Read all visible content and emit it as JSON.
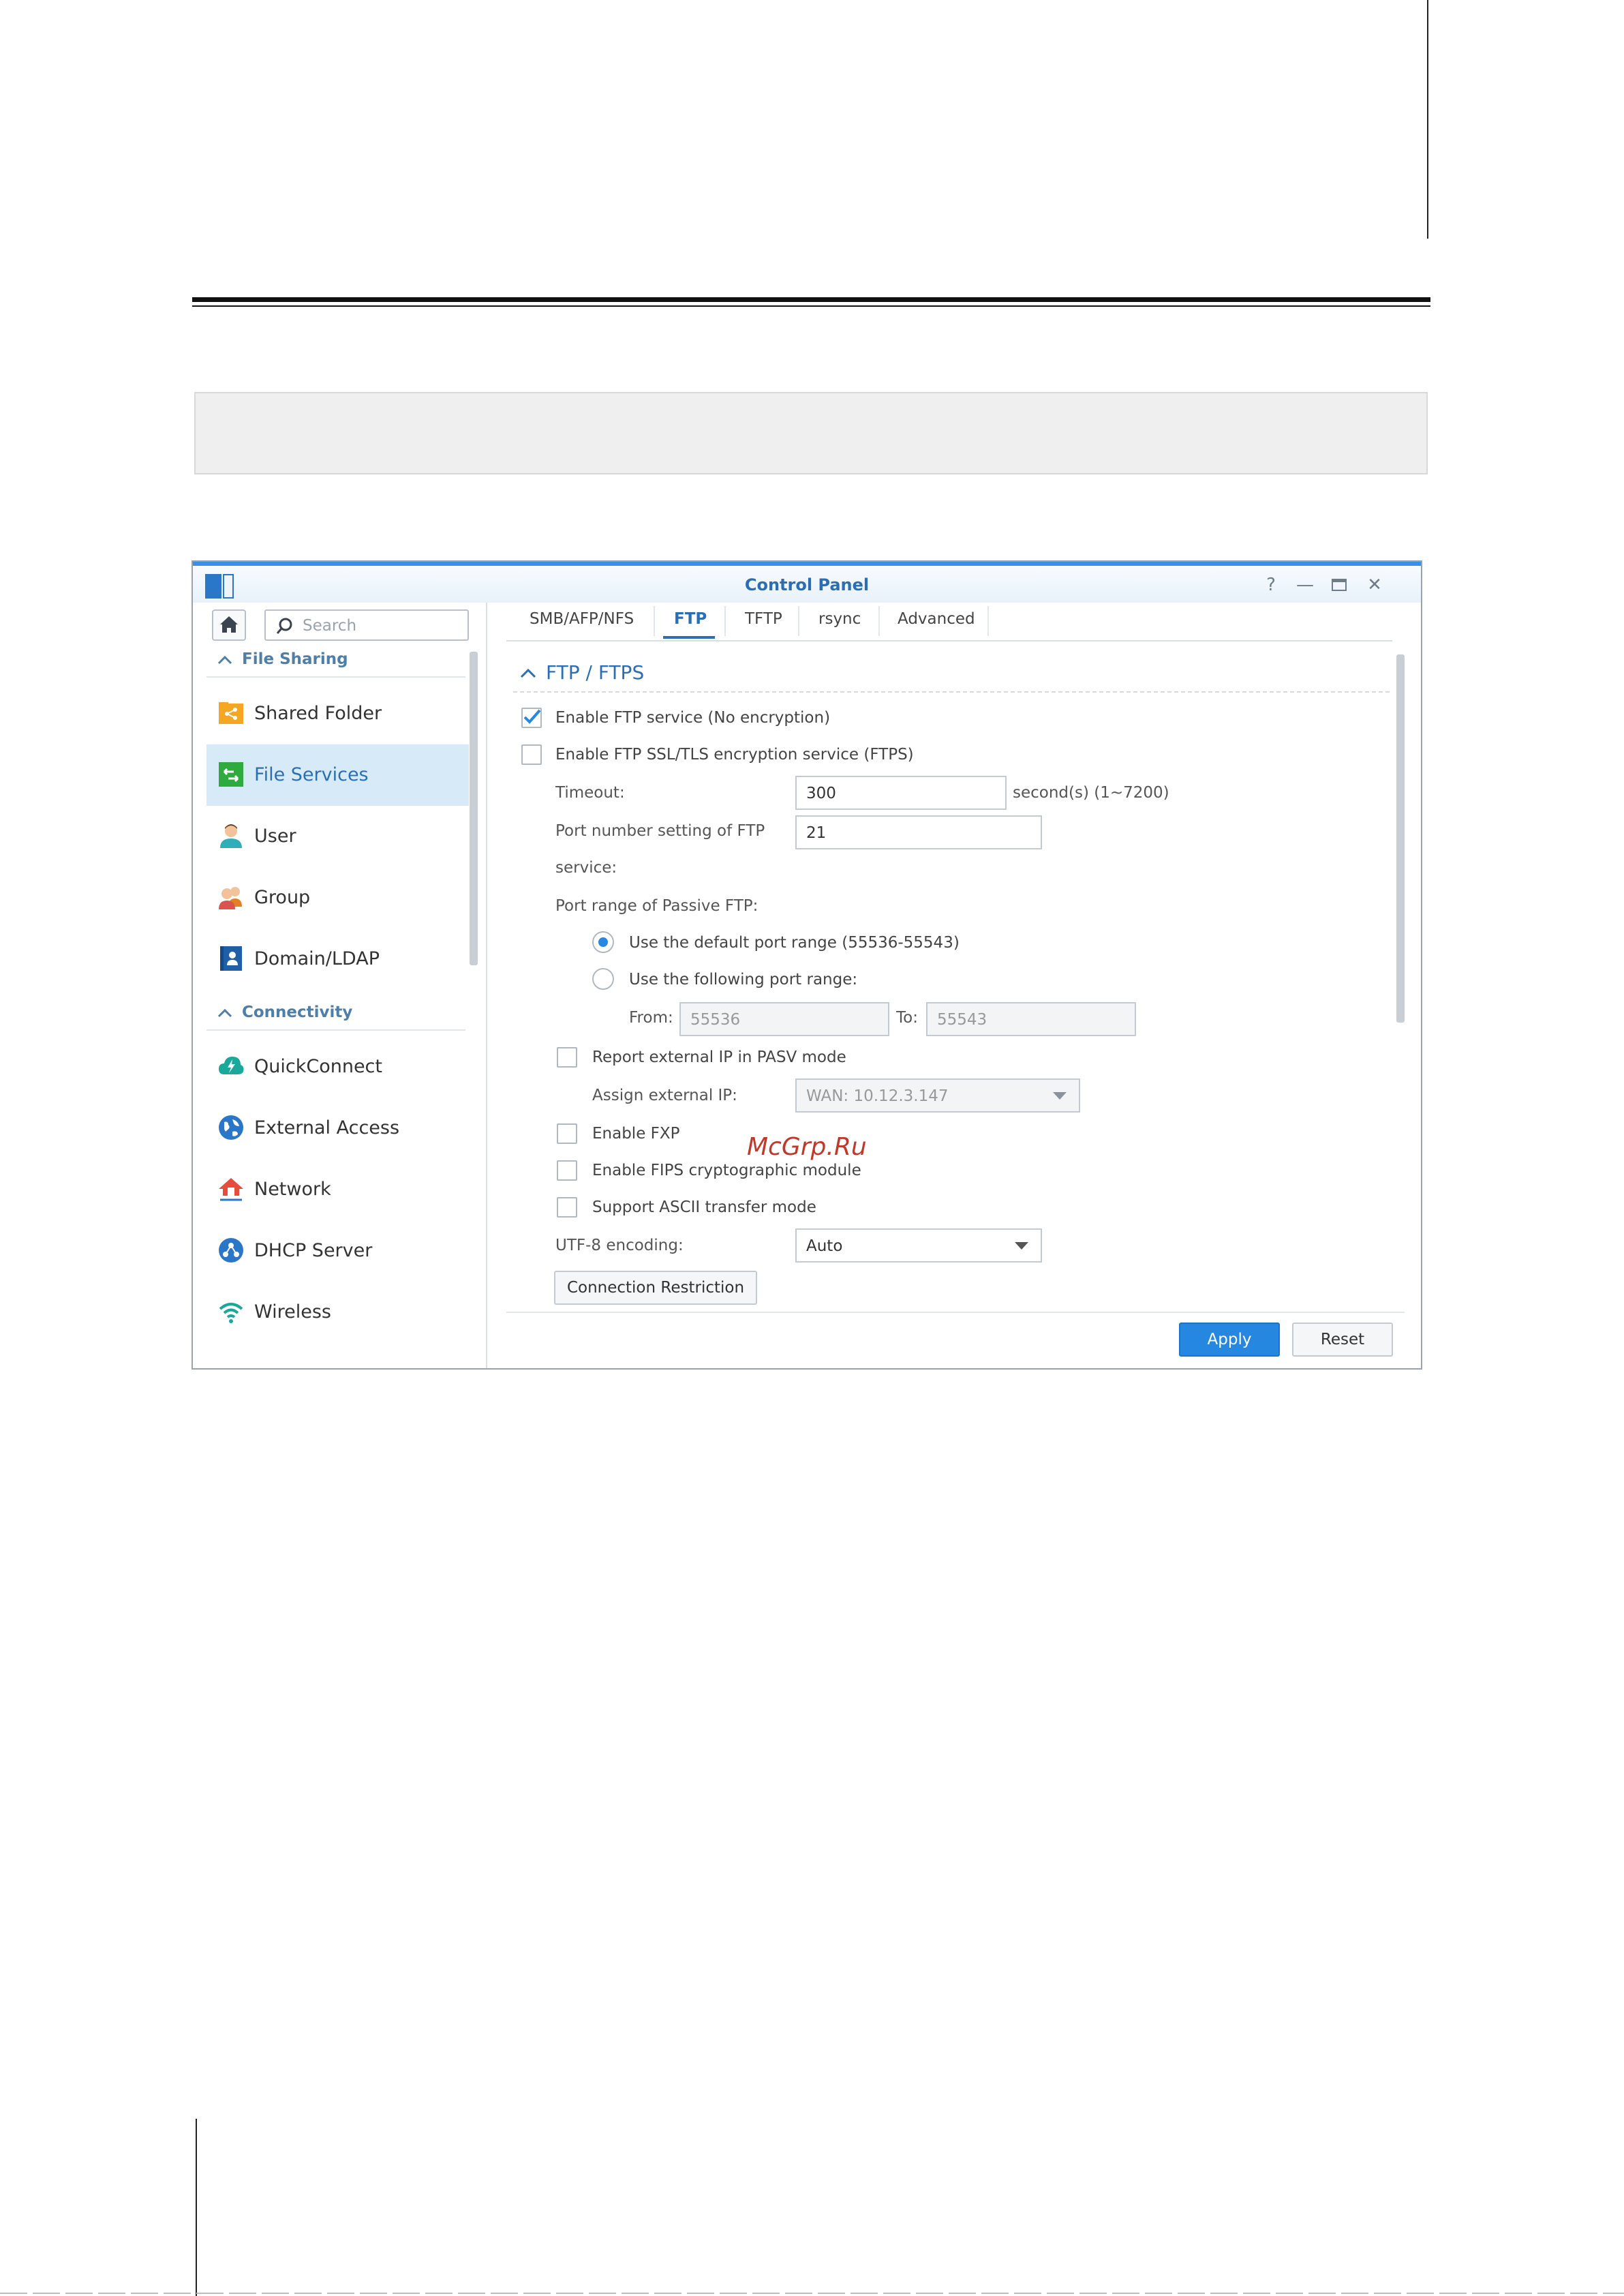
{
  "window": {
    "title": "Control Panel",
    "controls": {
      "help": "?",
      "minimize": "—",
      "maximize": "▭",
      "close": "✕"
    }
  },
  "sidebar": {
    "search_placeholder": "Search",
    "sections": [
      {
        "label": "File Sharing"
      },
      {
        "label": "Connectivity"
      }
    ],
    "items": [
      {
        "label": "Shared Folder",
        "icon": "shared-folder-icon",
        "active": false
      },
      {
        "label": "File Services",
        "icon": "file-services-icon",
        "active": true
      },
      {
        "label": "User",
        "icon": "user-icon",
        "active": false
      },
      {
        "label": "Group",
        "icon": "group-icon",
        "active": false
      },
      {
        "label": "Domain/LDAP",
        "icon": "domain-ldap-icon",
        "active": false
      },
      {
        "label": "QuickConnect",
        "icon": "quickconnect-icon",
        "active": false
      },
      {
        "label": "External Access",
        "icon": "external-access-icon",
        "active": false
      },
      {
        "label": "Network",
        "icon": "network-icon",
        "active": false
      },
      {
        "label": "DHCP Server",
        "icon": "dhcp-server-icon",
        "active": false
      },
      {
        "label": "Wireless",
        "icon": "wireless-icon",
        "active": false
      }
    ]
  },
  "tabs": [
    {
      "label": "SMB/AFP/NFS",
      "active": false
    },
    {
      "label": "FTP",
      "active": true
    },
    {
      "label": "TFTP",
      "active": false
    },
    {
      "label": "rsync",
      "active": false
    },
    {
      "label": "Advanced",
      "active": false
    }
  ],
  "ftp": {
    "section_title": "FTP / FTPS",
    "enable_ftp": {
      "label": "Enable FTP service (No encryption)",
      "checked": true
    },
    "enable_ftps": {
      "label": "Enable FTP SSL/TLS encryption service (FTPS)",
      "checked": false
    },
    "timeout": {
      "label": "Timeout:",
      "value": "300",
      "suffix": "second(s) (1~7200)"
    },
    "port": {
      "label_line1": "Port number setting of FTP",
      "label_line2": "service:",
      "value": "21"
    },
    "passive_label": "Port range of Passive FTP:",
    "default_range": {
      "label": "Use the default port range (55536-55543)",
      "selected": true
    },
    "custom_range": {
      "label": "Use the following port range:",
      "selected": false
    },
    "from": {
      "label": "From:",
      "value": "55536"
    },
    "to": {
      "label": "To:",
      "value": "55543"
    },
    "report_ext_ip": {
      "label": "Report external IP in PASV mode",
      "checked": false
    },
    "assign_ext_ip": {
      "label": "Assign external IP:",
      "value": "WAN: 10.12.3.147"
    },
    "enable_fxp": {
      "label": "Enable FXP",
      "checked": false
    },
    "enable_fips": {
      "label": "Enable FIPS cryptographic module",
      "checked": false
    },
    "ascii_mode": {
      "label": "Support ASCII transfer mode",
      "checked": false
    },
    "utf8": {
      "label": "UTF-8 encoding:",
      "value": "Auto"
    },
    "connection_restriction": "Connection Restriction"
  },
  "footer": {
    "apply": "Apply",
    "reset": "Reset"
  },
  "watermark": "McGrp.Ru",
  "colors": {
    "accent": "#2a6fb5",
    "primary_button": "#2587e0",
    "active_item_bg": "#d6eaf8"
  }
}
